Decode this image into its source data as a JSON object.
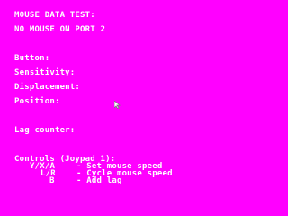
{
  "screen": {
    "background_color": "#ff00ff",
    "text_color": "#ffffff",
    "title": "MOUSE DATA TEST:",
    "status": "NO MOUSE ON PORT 2",
    "labels": {
      "button": "Button:",
      "sensitivity": "Sensitivity:",
      "displacement": "Displacement:",
      "position": "Position:",
      "lag_counter": "Lag counter:"
    },
    "controls": {
      "header": "Controls (Joypad 1):",
      "lines": [
        {
          "keys": "Y/X/A",
          "action": "- Set mouse speed"
        },
        {
          "keys": "L/R",
          "action": "- Cycle mouse speed"
        },
        {
          "keys": "B",
          "action": "- Add lag"
        }
      ]
    },
    "cursor_icon": "mouse-pointer-icon"
  }
}
